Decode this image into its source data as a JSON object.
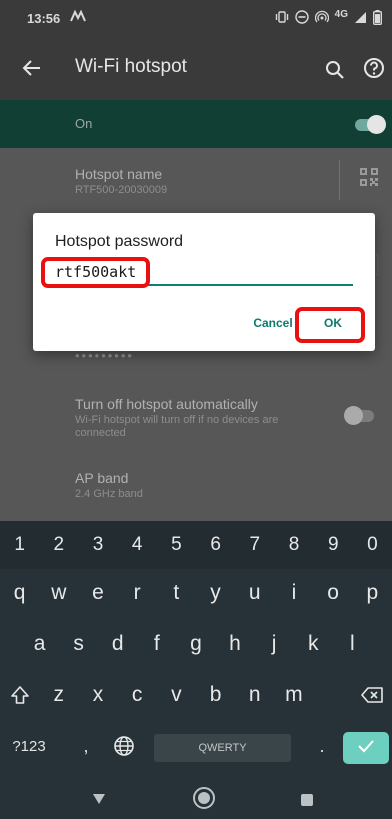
{
  "status_bar": {
    "time": "13:56",
    "network": "4G"
  },
  "app_bar": {
    "title": "Wi-Fi hotspot"
  },
  "hotspot_switch": {
    "label": "On",
    "state": "on"
  },
  "settings": {
    "hotspot_name": {
      "title": "Hotspot name",
      "value": "RTF500-20030009"
    },
    "password_masked": "•••••••••",
    "auto_off": {
      "title": "Turn off hotspot automatically",
      "subtitle": "Wi-Fi hotspot will turn off if no devices are connected",
      "state": "off"
    },
    "ap_band": {
      "title": "AP band",
      "value": "2.4 GHz band"
    }
  },
  "dialog": {
    "title": "Hotspot password",
    "password_value": "rtf500akt",
    "cancel_label": "Cancel",
    "ok_label": "OK"
  },
  "keyboard": {
    "numbers": [
      "1",
      "2",
      "3",
      "4",
      "5",
      "6",
      "7",
      "8",
      "9",
      "0"
    ],
    "row1": [
      "q",
      "w",
      "e",
      "r",
      "t",
      "y",
      "u",
      "i",
      "o",
      "p"
    ],
    "row2": [
      "a",
      "s",
      "d",
      "f",
      "g",
      "h",
      "j",
      "k",
      "l"
    ],
    "row3": [
      "z",
      "x",
      "c",
      "v",
      "b",
      "n",
      "m"
    ],
    "symbols_label": "?123",
    "comma": ",",
    "space_label": "QWERTY",
    "period": "."
  },
  "colors": {
    "accent": "#0c7a6e",
    "highlight": "#e81010",
    "toggle_on_bg": "#123f34",
    "keyboard_bg": "#263238"
  }
}
